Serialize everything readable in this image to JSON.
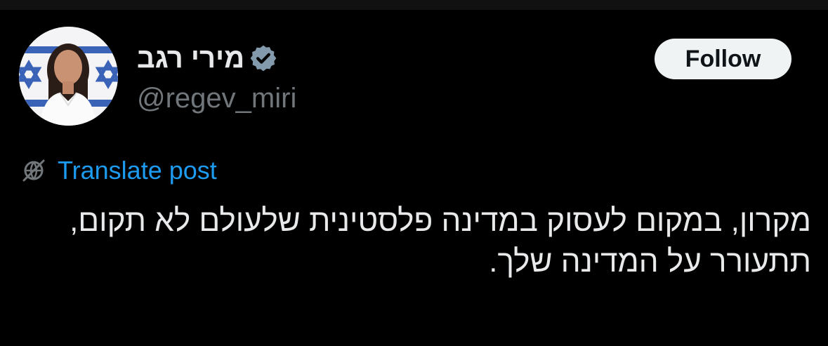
{
  "tweet": {
    "author": {
      "display_name": "מירי רגב",
      "handle": "@regev_miri",
      "verified_icon": "verified-badge-icon",
      "avatar": "profile-photo"
    },
    "follow_label": "Follow",
    "translate_label": "Translate post",
    "translate_icon": "globe-icon",
    "text": "מקרון, במקום לעסוק במדינה פלסטינית שלעולם לא תקום, תתעורר על המדינה שלך."
  },
  "colors": {
    "background": "#000000",
    "text_primary": "#e7e9ea",
    "text_secondary": "#71767b",
    "link": "#1d9bf0",
    "follow_bg": "#eff3f4",
    "verified_badge": "#829aab"
  }
}
